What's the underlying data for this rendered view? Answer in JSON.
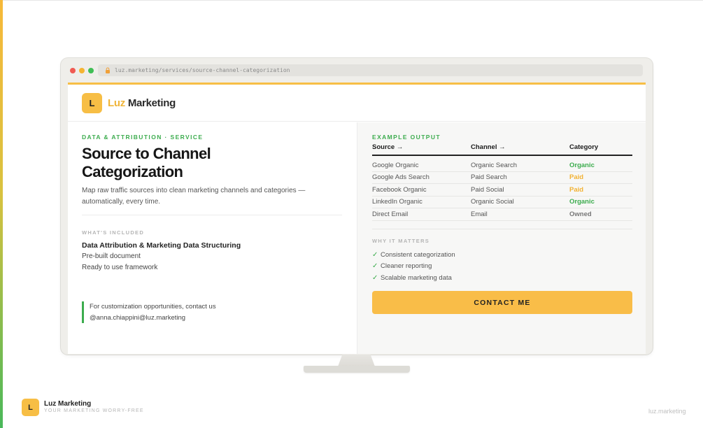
{
  "browser": {
    "url": "luz.marketing/services/source-channel-categorization"
  },
  "header": {
    "logo_letter": "L",
    "brand_part1": "Luz",
    "brand_part2": "Marketing"
  },
  "left": {
    "eyebrow": "DATA & ATTRIBUTION · SERVICE",
    "title_line1": "Source to Channel",
    "title_line2": "Categorization",
    "subtitle": "Map raw traffic sources into clean marketing channels and categories — automatically, every time.",
    "included_label": "WHAT'S INCLUDED",
    "included": [
      "Data Attribution & Marketing Data Structuring",
      "Pre-built document",
      "Ready to use framework"
    ],
    "contact_line1": "For customization opportunities, contact us",
    "contact_line2": "@anna.chiappini@luz.marketing"
  },
  "right": {
    "example_label": "EXAMPLE OUTPUT",
    "columns": [
      "Source →",
      "Channel →",
      "Category"
    ],
    "rows": [
      {
        "source": "Google Organic",
        "channel": "Organic Search",
        "category": "Organic",
        "color": "#3cac4e"
      },
      {
        "source": "Google Ads Search",
        "channel": "Paid Search",
        "category": "Paid",
        "color": "#f2b233"
      },
      {
        "source": "Facebook Organic",
        "channel": "Paid Social",
        "category": "Paid",
        "color": "#f2b233"
      },
      {
        "source": "LinkedIn Organic",
        "channel": "Organic Social",
        "category": "Organic",
        "color": "#3cac4e"
      },
      {
        "source": "Direct Email",
        "channel": "Email",
        "category": "Owned",
        "color": "#777777"
      }
    ],
    "why_label": "WHY IT MATTERS",
    "why": [
      "Consistent categorization",
      "Cleaner reporting",
      "Scalable marketing data"
    ],
    "check_glyph": "✓",
    "cta_label": "CONTACT ME"
  },
  "footer": {
    "logo_letter": "L",
    "name": "Luz Marketing",
    "tagline": "YOUR MARKETING WORRY-FREE",
    "domain": "luz.marketing"
  },
  "colors": {
    "accent": "#f7be45",
    "green": "#3cac4e"
  }
}
